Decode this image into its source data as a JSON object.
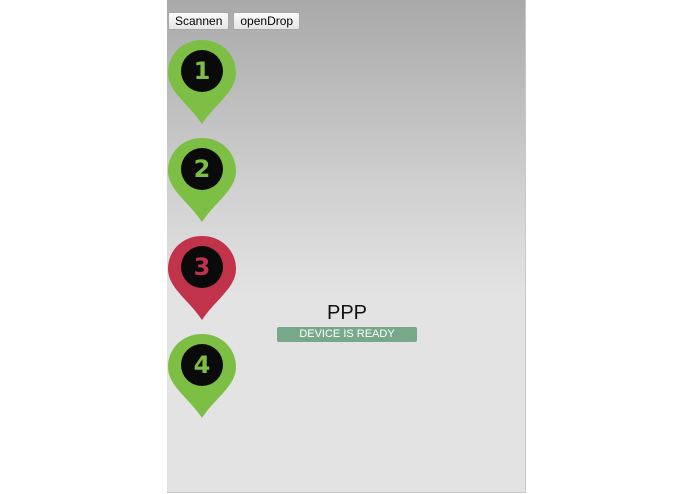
{
  "toolbar": {
    "scan_label": "Scannen",
    "open_drop_label": "openDrop"
  },
  "pins": [
    {
      "label": "1",
      "status": "ok",
      "color": "#7dbf45",
      "number_color": "#7dbf45"
    },
    {
      "label": "2",
      "status": "ok",
      "color": "#7dbf45",
      "number_color": "#7dbf45"
    },
    {
      "label": "3",
      "status": "alert",
      "color": "#c0334a",
      "number_color": "#c0334a"
    },
    {
      "label": "4",
      "status": "ok",
      "color": "#7dbf45",
      "number_color": "#7dbf45"
    }
  ],
  "app": {
    "title": "PPP",
    "status": "DEVICE IS READY",
    "status_color": "#78a88a"
  }
}
